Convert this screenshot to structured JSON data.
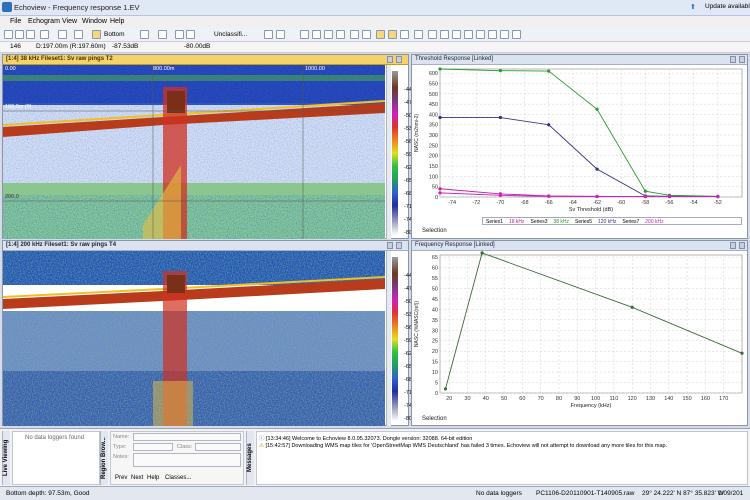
{
  "window": {
    "title": "Echoview - Frequency response 1.EV",
    "update": "Update available"
  },
  "menu": [
    "File",
    "Echogram",
    "View",
    "Window",
    "Help"
  ],
  "toolbar": {
    "bottom_label": "Bottom",
    "class_label": "Unclassifi..."
  },
  "info": {
    "ping": "146",
    "depth": "D:197.00m (R:197.60m)",
    "sv": "-87.53dB",
    "threshold": "-80.00dB"
  },
  "echo1": {
    "title": "[1:4] 38 kHz Fileset1: Sv raw pings T2",
    "ticks": [
      "0.00",
      "800.00m",
      "1000.00"
    ],
    "depth100": "100.0m (0)",
    "depth200": "200.0"
  },
  "echo2": {
    "title": "[1:4] 200 kHz Fileset1: Sv raw pings T4"
  },
  "colorscale": [
    "-44",
    "-47",
    "-50",
    "-53",
    "-56",
    "-59",
    "-62",
    "-65",
    "-68",
    "-71",
    "-74",
    "-77",
    "-80"
  ],
  "colors": {
    "accent": "#f3d36a",
    "grid": "#d6dbe9"
  },
  "chart1": {
    "title": "Threshold Response [Linked]",
    "selection": "Selection",
    "legend": [
      "Series1",
      "18 kHz",
      "Series3",
      "38 kHz",
      "Series5",
      "120 kHz",
      "Series7",
      "200 kHz"
    ]
  },
  "chart2": {
    "title": "Frequency Response [Linked]",
    "selection": "Selection"
  },
  "chart_data": [
    {
      "type": "line",
      "title": "Threshold Response [Linked]",
      "xlabel": "Sv Threshold (dB)",
      "ylabel": "NASC (m2nmi-2)",
      "xlim": [
        -75,
        -50
      ],
      "ylim": [
        0,
        620
      ],
      "xticks": [
        -74,
        -72,
        -70,
        -68,
        -66,
        -64,
        -62,
        -60,
        -58,
        -56,
        -54,
        -52
      ],
      "yticks": [
        0,
        50,
        100,
        150,
        200,
        250,
        300,
        350,
        400,
        450,
        500,
        550,
        600
      ],
      "x": [
        -75,
        -70,
        -66,
        -62,
        -58,
        -56,
        -52
      ],
      "series": [
        {
          "name": "18 kHz",
          "color": "#c020a0",
          "values": [
            40,
            15,
            5,
            3,
            2,
            2,
            2
          ]
        },
        {
          "name": "38 kHz",
          "color": "#2a9a2a",
          "values": [
            620,
            612,
            610,
            425,
            28,
            8,
            3
          ]
        },
        {
          "name": "120 kHz",
          "color": "#30308a",
          "values": [
            385,
            385,
            350,
            135,
            5,
            3,
            2
          ]
        },
        {
          "name": "200 kHz",
          "color": "#d020c0",
          "values": [
            20,
            8,
            3,
            2,
            2,
            2,
            2
          ]
        }
      ]
    },
    {
      "type": "line",
      "title": "Frequency Response [Linked]",
      "xlabel": "Frequency (kHz)",
      "ylabel": "NASC (%NASC(ref))",
      "xlim": [
        15,
        180
      ],
      "ylim": [
        0,
        66
      ],
      "xticks": [
        20,
        30,
        40,
        50,
        60,
        70,
        80,
        90,
        100,
        110,
        120,
        130,
        140,
        150,
        160,
        170
      ],
      "yticks": [
        0,
        5,
        10,
        15,
        20,
        25,
        30,
        35,
        40,
        45,
        50,
        55,
        60,
        65
      ],
      "series": [
        {
          "name": "Frequency response",
          "color": "#3a6a3a",
          "x": [
            18,
            38,
            120,
            180
          ],
          "values": [
            2,
            67,
            41,
            19
          ]
        }
      ]
    }
  ],
  "bottom_panel": {
    "loggers": "No data loggers found",
    "tab_live": "Live Viewing",
    "tab_region": "Region Brow...",
    "tab_messages": "Messages",
    "name_label": "Name:",
    "type_label": "Type:",
    "class_label": "Class:",
    "notes_label": "Notes:",
    "prev": "Prev",
    "next": "Next",
    "help": "Help",
    "classes": "Classes...",
    "messages": [
      "[13:34:46] Welcome to Echoview 8.0.95.32073. Dongle version: 32088. 64-bit edition",
      "[15:42:57] Downloading WMS map tiles for 'OpenStreetMap WMS Deutschland' has failed 3 times. Echoview will not attempt to download any more tiles for this map."
    ]
  },
  "status": {
    "depth": "Bottom depth: 97.53m, Good",
    "loggers": "No data loggers",
    "file": "PC1106-D20110901-T140905.raw",
    "lat": "29° 24.222' N 87° 35.823' W",
    "date": "1/09/201"
  }
}
